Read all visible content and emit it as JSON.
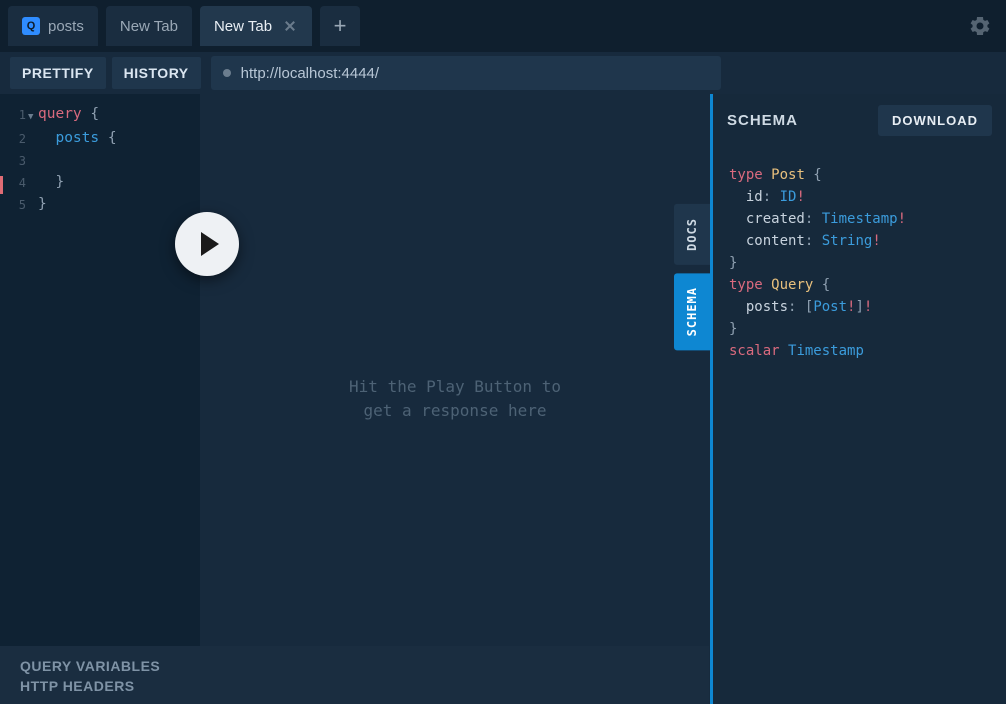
{
  "tabs": [
    {
      "label": "posts",
      "icon": "Q"
    },
    {
      "label": "New Tab"
    },
    {
      "label": "New Tab",
      "active": true,
      "closable": true
    }
  ],
  "toolbar": {
    "prettify": "PRETTIFY",
    "history": "HISTORY",
    "url": "http://localhost:4444/"
  },
  "editor": {
    "lines": [
      {
        "n": 1,
        "t": [
          "query",
          " {"
        ],
        "c": [
          "kw-red",
          "brace"
        ],
        "fold": true
      },
      {
        "n": 2,
        "t": [
          "  posts",
          " {"
        ],
        "c": [
          "kw-blue",
          "brace"
        ]
      },
      {
        "n": 3,
        "t": [
          ""
        ],
        "c": [
          ""
        ]
      },
      {
        "n": 4,
        "t": [
          "  }"
        ],
        "c": [
          "brace"
        ]
      },
      {
        "n": 5,
        "t": [
          "}"
        ],
        "c": [
          "brace"
        ]
      }
    ]
  },
  "placeholder": "Hit the Play Button to\nget a response here",
  "sideTabs": {
    "docs": "DOCS",
    "schema": "SCHEMA"
  },
  "schema": {
    "title": "SCHEMA",
    "download": "DOWNLOAD",
    "sdl": [
      [
        [
          "s-kw",
          "type"
        ],
        [
          "",
          " "
        ],
        [
          "s-typedef",
          "Post"
        ],
        [
          "s-punct",
          " {"
        ]
      ],
      [
        [
          "",
          "  "
        ],
        [
          "s-field",
          "id"
        ],
        [
          "s-punct",
          ": "
        ],
        [
          "s-type",
          "ID"
        ],
        [
          "s-bang",
          "!"
        ]
      ],
      [
        [
          "",
          "  "
        ],
        [
          "s-field",
          "created"
        ],
        [
          "s-punct",
          ": "
        ],
        [
          "s-type",
          "Timestamp"
        ],
        [
          "s-bang",
          "!"
        ]
      ],
      [
        [
          "",
          "  "
        ],
        [
          "s-field",
          "content"
        ],
        [
          "s-punct",
          ": "
        ],
        [
          "s-type",
          "String"
        ],
        [
          "s-bang",
          "!"
        ]
      ],
      [
        [
          "s-punct",
          "}"
        ]
      ],
      [
        [
          "",
          ""
        ]
      ],
      [
        [
          "s-kw",
          "type"
        ],
        [
          "",
          " "
        ],
        [
          "s-typedef",
          "Query"
        ],
        [
          "s-punct",
          " {"
        ]
      ],
      [
        [
          "",
          "  "
        ],
        [
          "s-field",
          "posts"
        ],
        [
          "s-punct",
          ": ["
        ],
        [
          "s-type",
          "Post"
        ],
        [
          "s-bang",
          "!"
        ],
        [
          "s-punct",
          "]"
        ],
        [
          "s-bang",
          "!"
        ]
      ],
      [
        [
          "s-punct",
          "}"
        ]
      ],
      [
        [
          "",
          ""
        ]
      ],
      [
        [
          "s-kw",
          "scalar"
        ],
        [
          "",
          " "
        ],
        [
          "s-type",
          "Timestamp"
        ]
      ]
    ]
  },
  "footer": {
    "qv": "QUERY VARIABLES",
    "hh": "HTTP HEADERS"
  }
}
